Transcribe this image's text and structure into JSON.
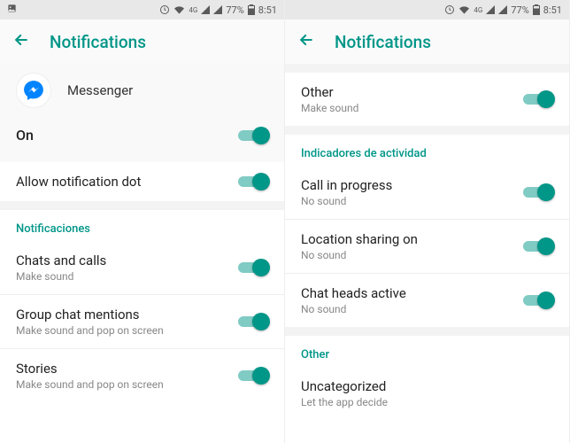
{
  "statusbar": {
    "battery": "77%",
    "time": "8:51",
    "network": "4G"
  },
  "left": {
    "page_title": "Notifications",
    "app_name": "Messenger",
    "on_label": "On",
    "allow_dot": "Allow notification dot",
    "section_notifications": "Notificaciones",
    "items": [
      {
        "label": "Chats and calls",
        "sub": "Make sound"
      },
      {
        "label": "Group chat mentions",
        "sub": "Make sound and pop on screen"
      },
      {
        "label": "Stories",
        "sub": "Make sound and pop on screen"
      }
    ]
  },
  "right": {
    "page_title": "Notifications",
    "other_item": {
      "label": "Other",
      "sub": "Make sound"
    },
    "section_activity": "Indicadores de actividad",
    "activity_items": [
      {
        "label": "Call in progress",
        "sub": "No sound"
      },
      {
        "label": "Location sharing on",
        "sub": "No sound"
      },
      {
        "label": "Chat heads active",
        "sub": "No sound"
      }
    ],
    "section_other": "Other",
    "uncategorized": {
      "label": "Uncategorized",
      "sub": "Let the app decide"
    }
  }
}
